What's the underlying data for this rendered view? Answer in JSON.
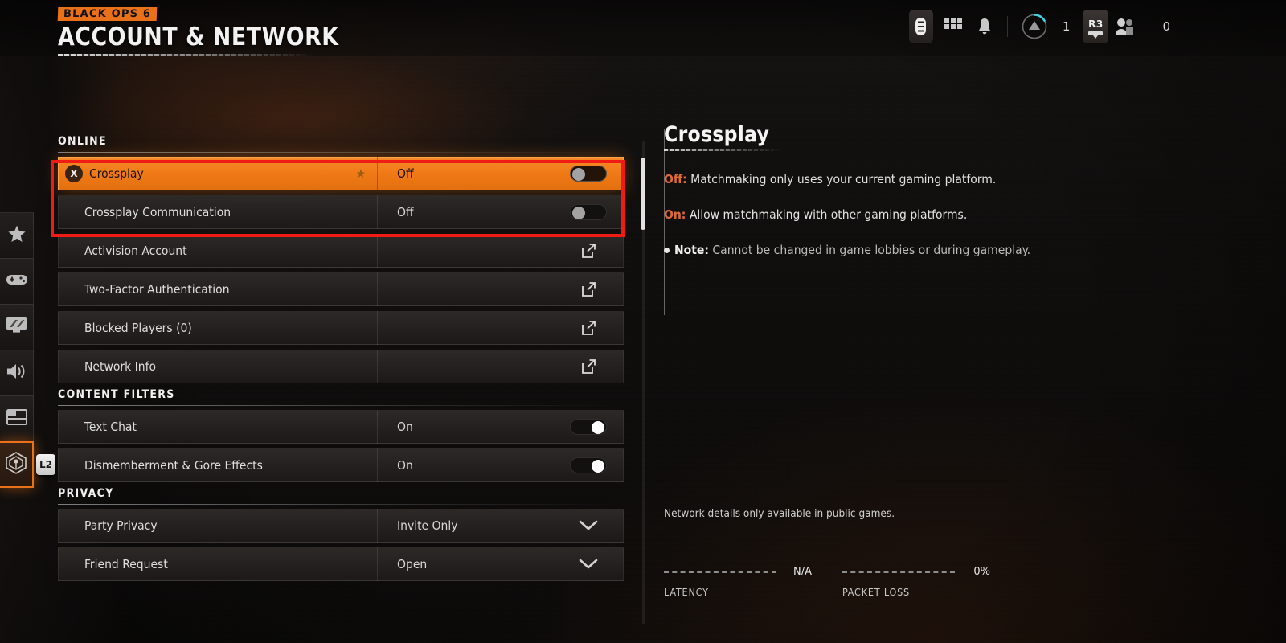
{
  "header": {
    "badge": "BLACK OPS 6",
    "title": "ACCOUNT & NETWORK"
  },
  "hud": {
    "icons": [
      {
        "name": "battery-menu-icon"
      },
      {
        "name": "grid-apps-icon"
      },
      {
        "name": "bell-notifications-icon"
      },
      {
        "name": "rank-progress-icon"
      }
    ],
    "rank_count": "1",
    "key_badge": "R3",
    "party_icon": "party-members-icon",
    "party_count": "0"
  },
  "rail": {
    "items": [
      {
        "name": "sidebar-item-favorites",
        "icon": "star-icon"
      },
      {
        "name": "sidebar-item-controller",
        "icon": "gamepad-icon"
      },
      {
        "name": "sidebar-item-graphics",
        "icon": "monitor-icon"
      },
      {
        "name": "sidebar-item-audio",
        "icon": "speaker-icon"
      },
      {
        "name": "sidebar-item-interface",
        "icon": "layout-icon"
      },
      {
        "name": "sidebar-item-account-network",
        "icon": "network-signal-icon",
        "active": true
      }
    ],
    "shortcut_badge": "L2"
  },
  "settings": {
    "groups": [
      {
        "title": "ONLINE",
        "rows": [
          {
            "label": "Crossplay",
            "value": "Off",
            "control": "toggle",
            "toggle_on": false,
            "selected": true,
            "starred": true,
            "button_glyph": "X"
          },
          {
            "label": "Crossplay Communication",
            "value": "Off",
            "control": "toggle",
            "toggle_on": false
          },
          {
            "label": "Activision Account",
            "value": "",
            "control": "external-link"
          },
          {
            "label": "Two-Factor Authentication",
            "value": "",
            "control": "external-link"
          },
          {
            "label": "Blocked Players (0)",
            "value": "",
            "control": "external-link"
          },
          {
            "label": "Network Info",
            "value": "",
            "control": "external-link"
          }
        ]
      },
      {
        "title": "CONTENT FILTERS",
        "rows": [
          {
            "label": "Text Chat",
            "value": "On",
            "control": "toggle",
            "toggle_on": true
          },
          {
            "label": "Dismemberment & Gore Effects",
            "value": "On",
            "control": "toggle",
            "toggle_on": true
          }
        ]
      },
      {
        "title": "PRIVACY",
        "rows": [
          {
            "label": "Party Privacy",
            "value": "Invite Only",
            "control": "chevron-down"
          },
          {
            "label": "Friend Request",
            "value": "Open",
            "control": "chevron-down"
          }
        ]
      }
    ]
  },
  "detail": {
    "title": "Crossplay",
    "lines": [
      {
        "keyword": "Off:",
        "text": "Matchmaking only uses your current gaming platform."
      },
      {
        "keyword": "On:",
        "text": "Allow matchmaking with other gaming platforms."
      }
    ],
    "note_keyword": "Note:",
    "note_text": "Cannot be changed in game lobbies or during gameplay.",
    "network_availability": "Network details only available in public games.",
    "stats": [
      {
        "label": "LATENCY",
        "value": "N/A"
      },
      {
        "label": "PACKET LOSS",
        "value": "0%"
      }
    ]
  },
  "colors": {
    "accent_orange": "#f07a16",
    "annotation_red": "#ef1b14",
    "keyword_orange": "#e06a33",
    "rank_cyan": "#44d2e0"
  }
}
